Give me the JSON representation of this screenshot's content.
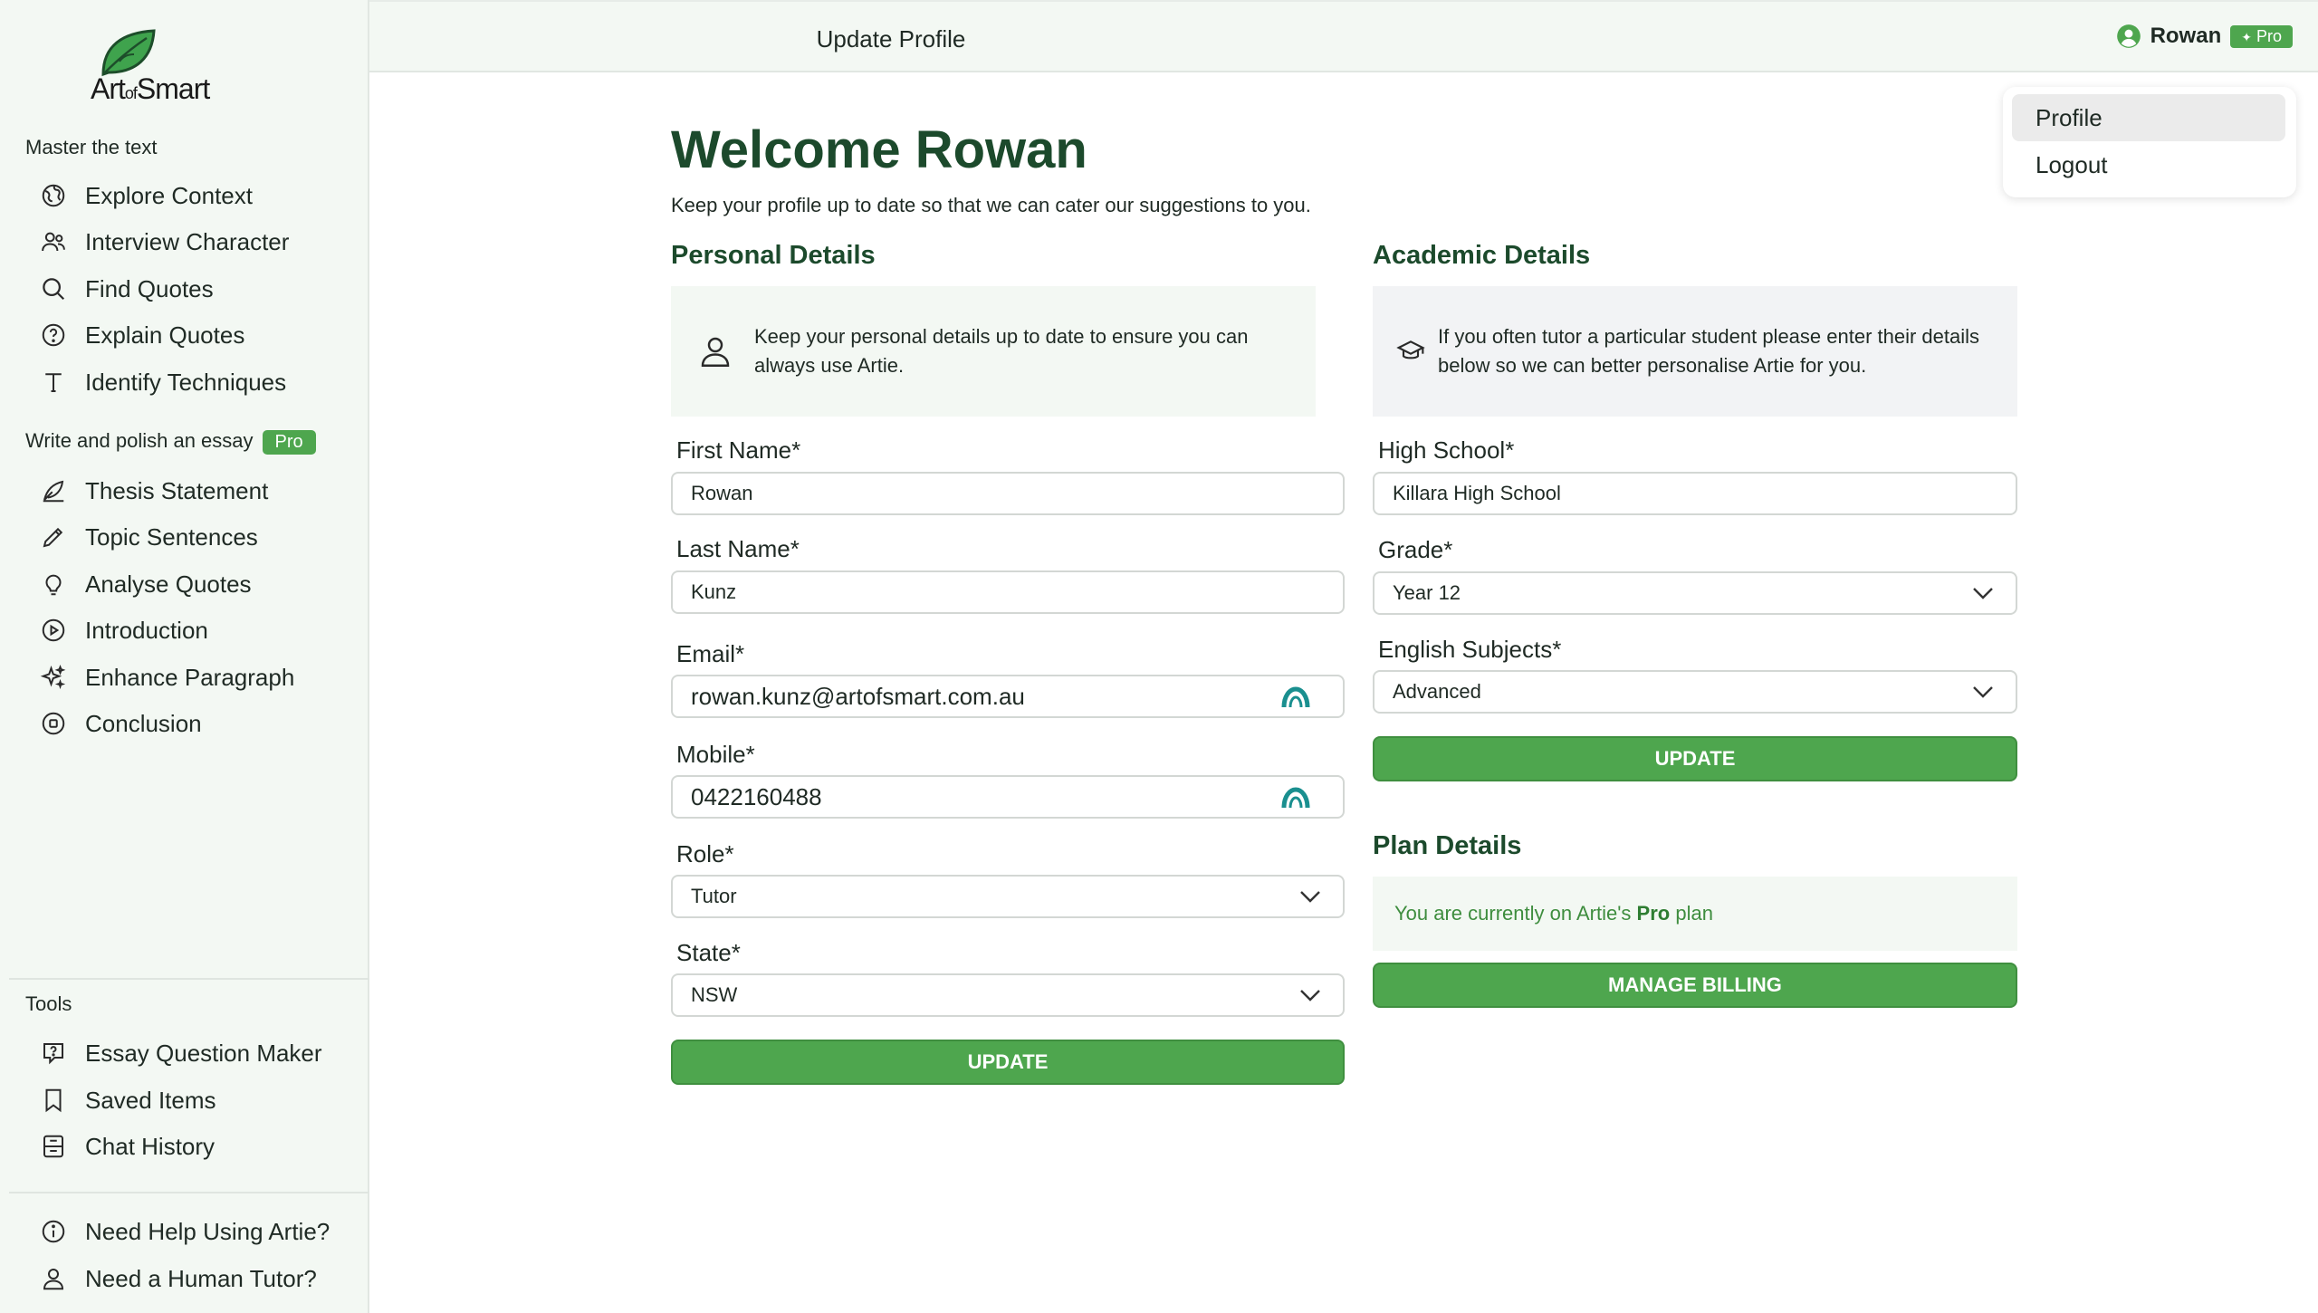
{
  "sidebar": {
    "logo_text": "Art",
    "logo_small": "of",
    "logo_text2": "Smart",
    "section1_title": "Master the text",
    "section1_items": [
      {
        "label": "Explore Context",
        "icon": "globe-icon"
      },
      {
        "label": "Interview Character",
        "icon": "users-icon"
      },
      {
        "label": "Find Quotes",
        "icon": "search-icon"
      },
      {
        "label": "Explain Quotes",
        "icon": "question-circle-icon"
      },
      {
        "label": "Identify Techniques",
        "icon": "text-t-icon"
      }
    ],
    "section2_title": "Write and polish an essay",
    "section2_badge": "Pro",
    "section2_items": [
      {
        "label": "Thesis Statement",
        "icon": "quill-icon"
      },
      {
        "label": "Topic Sentences",
        "icon": "pencil-icon"
      },
      {
        "label": "Analyse Quotes",
        "icon": "lightbulb-icon"
      },
      {
        "label": "Introduction",
        "icon": "play-circle-icon"
      },
      {
        "label": "Enhance Paragraph",
        "icon": "sparkles-icon"
      },
      {
        "label": "Conclusion",
        "icon": "stop-circle-icon"
      }
    ],
    "tools_title": "Tools",
    "tools_items": [
      {
        "label": "Essay Question Maker",
        "icon": "message-question-icon"
      },
      {
        "label": "Saved Items",
        "icon": "bookmark-icon"
      },
      {
        "label": "Chat History",
        "icon": "archive-icon"
      }
    ],
    "help_items": [
      {
        "label": "Need Help Using Artie?",
        "icon": "info-icon"
      },
      {
        "label": "Need a Human Tutor?",
        "icon": "user-icon"
      }
    ]
  },
  "topbar": {
    "title": "Update Profile",
    "user_name": "Rowan",
    "user_badge": "Pro"
  },
  "user_menu": {
    "items": [
      "Profile",
      "Logout"
    ],
    "active": "Profile"
  },
  "main": {
    "welcome": "Welcome Rowan",
    "subtitle": "Keep your profile up to date so that we can cater our suggestions to you.",
    "personal": {
      "heading": "Personal Details",
      "info": "Keep your personal details up to date to ensure you can always use Artie.",
      "first_name_label": "First Name*",
      "first_name": "Rowan",
      "last_name_label": "Last Name*",
      "last_name": "Kunz",
      "email_label": "Email*",
      "email": "rowan.kunz@artofsmart.com.au",
      "mobile_label": "Mobile*",
      "mobile": "0422160488",
      "role_label": "Role*",
      "role": "Tutor",
      "state_label": "State*",
      "state": "NSW",
      "update_button": "UPDATE"
    },
    "academic": {
      "heading": "Academic Details",
      "info": "If you often tutor a particular student please enter their details below so we can better personalise Artie for you.",
      "school_label": "High School*",
      "school": "Killara High School",
      "grade_label": "Grade*",
      "grade": "Year 12",
      "subjects_label": "English Subjects*",
      "subjects": "Advanced",
      "update_button": "UPDATE"
    },
    "plan": {
      "heading": "Plan Details",
      "text_prefix": "You are currently on Artie's",
      "plan_name": "Pro",
      "text_suffix": "plan",
      "billing_button": "MANAGE BILLING"
    }
  },
  "colors": {
    "accent_green": "#4ea64e",
    "heading_green": "#1c4a2c",
    "sidebar_bg": "#f3f8f3"
  }
}
